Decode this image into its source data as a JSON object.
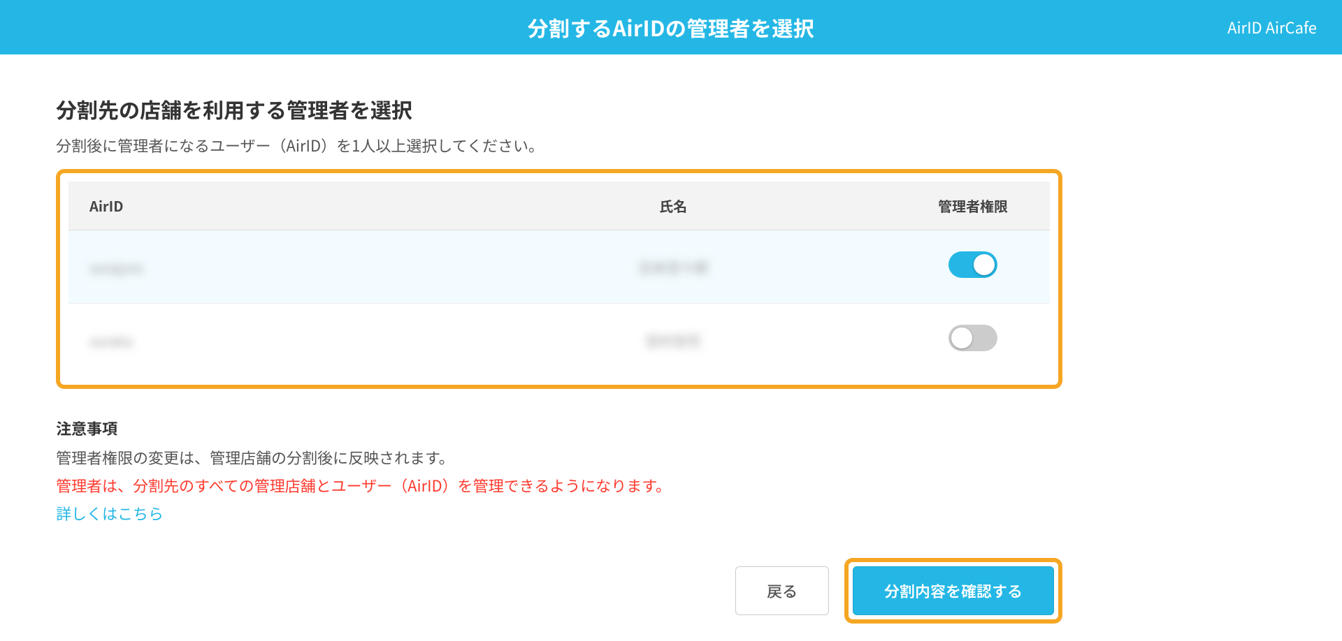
{
  "header": {
    "title": "分割するAirIDの管理者を選択",
    "account": "AirID AirCafe"
  },
  "section": {
    "title": "分割先の店舗を利用する管理者を選択",
    "desc": "分割後に管理者になるユーザー（AirID）を1人以上選択してください。"
  },
  "table": {
    "columns": {
      "airid": "AirID",
      "name": "氏名",
      "admin": "管理者権限"
    },
    "rows": [
      {
        "airid": "sorajuro",
        "name": "日本空十郎",
        "admin": true
      },
      {
        "airid": "soraka",
        "name": "空村空花",
        "admin": false
      }
    ]
  },
  "notes": {
    "title": "注意事項",
    "line1": "管理者権限の変更は、管理店舗の分割後に反映されます。",
    "warn": "管理者は、分割先のすべての管理店舗とユーザー（AirID）を管理できるようになります。",
    "link": "詳しくはこちら"
  },
  "buttons": {
    "back": "戻る",
    "confirm": "分割内容を確認する"
  }
}
